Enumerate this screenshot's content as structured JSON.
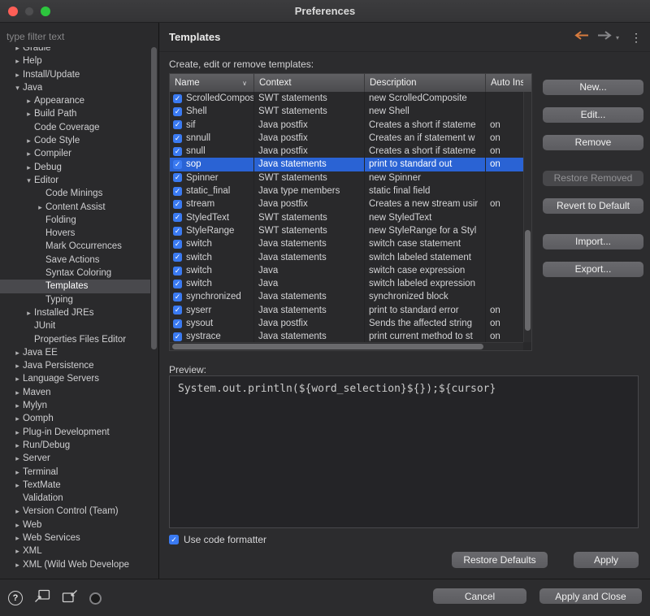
{
  "window": {
    "title": "Preferences"
  },
  "icons": {
    "check": "✓",
    "chevron_right": "▸",
    "chevron_down": "▾",
    "menu_dots": "⋮",
    "sort_down": "∨",
    "forward_dd": "▾",
    "help": "?"
  },
  "sidebar": {
    "filter_placeholder": "type filter text",
    "items": [
      {
        "label": "Gradle",
        "level": 0,
        "arrow": "right"
      },
      {
        "label": "Help",
        "level": 0,
        "arrow": "right"
      },
      {
        "label": "Install/Update",
        "level": 0,
        "arrow": "right"
      },
      {
        "label": "Java",
        "level": 0,
        "arrow": "down"
      },
      {
        "label": "Appearance",
        "level": 1,
        "arrow": "right"
      },
      {
        "label": "Build Path",
        "level": 1,
        "arrow": "right"
      },
      {
        "label": "Code Coverage",
        "level": 1,
        "arrow": "none"
      },
      {
        "label": "Code Style",
        "level": 1,
        "arrow": "right"
      },
      {
        "label": "Compiler",
        "level": 1,
        "arrow": "right"
      },
      {
        "label": "Debug",
        "level": 1,
        "arrow": "right"
      },
      {
        "label": "Editor",
        "level": 1,
        "arrow": "down"
      },
      {
        "label": "Code Minings",
        "level": 2,
        "arrow": "none"
      },
      {
        "label": "Content Assist",
        "level": 2,
        "arrow": "right"
      },
      {
        "label": "Folding",
        "level": 2,
        "arrow": "none"
      },
      {
        "label": "Hovers",
        "level": 2,
        "arrow": "none"
      },
      {
        "label": "Mark Occurrences",
        "level": 2,
        "arrow": "none"
      },
      {
        "label": "Save Actions",
        "level": 2,
        "arrow": "none"
      },
      {
        "label": "Syntax Coloring",
        "level": 2,
        "arrow": "none"
      },
      {
        "label": "Templates",
        "level": 2,
        "arrow": "none",
        "selected": true
      },
      {
        "label": "Typing",
        "level": 2,
        "arrow": "none"
      },
      {
        "label": "Installed JREs",
        "level": 1,
        "arrow": "right"
      },
      {
        "label": "JUnit",
        "level": 1,
        "arrow": "none"
      },
      {
        "label": "Properties Files Editor",
        "level": 1,
        "arrow": "none"
      },
      {
        "label": "Java EE",
        "level": 0,
        "arrow": "right"
      },
      {
        "label": "Java Persistence",
        "level": 0,
        "arrow": "right"
      },
      {
        "label": "Language Servers",
        "level": 0,
        "arrow": "right"
      },
      {
        "label": "Maven",
        "level": 0,
        "arrow": "right"
      },
      {
        "label": "Mylyn",
        "level": 0,
        "arrow": "right"
      },
      {
        "label": "Oomph",
        "level": 0,
        "arrow": "right"
      },
      {
        "label": "Plug-in Development",
        "level": 0,
        "arrow": "right"
      },
      {
        "label": "Run/Debug",
        "level": 0,
        "arrow": "right"
      },
      {
        "label": "Server",
        "level": 0,
        "arrow": "right"
      },
      {
        "label": "Terminal",
        "level": 0,
        "arrow": "right"
      },
      {
        "label": "TextMate",
        "level": 0,
        "arrow": "right"
      },
      {
        "label": "Validation",
        "level": 0,
        "arrow": "none"
      },
      {
        "label": "Version Control (Team)",
        "level": 0,
        "arrow": "right"
      },
      {
        "label": "Web",
        "level": 0,
        "arrow": "right"
      },
      {
        "label": "Web Services",
        "level": 0,
        "arrow": "right"
      },
      {
        "label": "XML",
        "level": 0,
        "arrow": "right"
      },
      {
        "label": "XML (Wild Web Develope",
        "level": 0,
        "arrow": "right"
      }
    ]
  },
  "main": {
    "title": "Templates",
    "subtitle": "Create, edit or remove templates:",
    "table": {
      "columns": [
        "Name",
        "Context",
        "Description",
        "Auto Insert"
      ],
      "rows": [
        {
          "name": "ScrolledComposite",
          "context": "SWT statements",
          "description": "new ScrolledComposite",
          "auto": "",
          "checked": true
        },
        {
          "name": "Shell",
          "context": "SWT statements",
          "description": "new Shell",
          "auto": "",
          "checked": true
        },
        {
          "name": "sif",
          "context": "Java postfix",
          "description": "Creates a short if stateme",
          "auto": "on",
          "checked": true
        },
        {
          "name": "snnull",
          "context": "Java postfix",
          "description": "Creates an if statement w",
          "auto": "on",
          "checked": true
        },
        {
          "name": "snull",
          "context": "Java postfix",
          "description": "Creates a short if stateme",
          "auto": "on",
          "checked": true
        },
        {
          "name": "sop",
          "context": "Java statements",
          "description": "print to standard out",
          "auto": "on",
          "checked": true,
          "selected": true
        },
        {
          "name": "Spinner",
          "context": "SWT statements",
          "description": "new Spinner",
          "auto": "",
          "checked": true
        },
        {
          "name": "static_final",
          "context": "Java type members",
          "description": "static final field",
          "auto": "",
          "checked": true
        },
        {
          "name": "stream",
          "context": "Java postfix",
          "description": "Creates a new stream usir",
          "auto": "on",
          "checked": true
        },
        {
          "name": "StyledText",
          "context": "SWT statements",
          "description": "new StyledText",
          "auto": "",
          "checked": true
        },
        {
          "name": "StyleRange",
          "context": "SWT statements",
          "description": "new StyleRange for a Styl",
          "auto": "",
          "checked": true
        },
        {
          "name": "switch",
          "context": "Java statements",
          "description": "switch case statement",
          "auto": "",
          "checked": true
        },
        {
          "name": "switch",
          "context": "Java statements",
          "description": "switch labeled statement",
          "auto": "",
          "checked": true
        },
        {
          "name": "switch",
          "context": "Java",
          "description": "switch case expression",
          "auto": "",
          "checked": true
        },
        {
          "name": "switch",
          "context": "Java",
          "description": "switch labeled expression",
          "auto": "",
          "checked": true
        },
        {
          "name": "synchronized",
          "context": "Java statements",
          "description": "synchronized block",
          "auto": "",
          "checked": true
        },
        {
          "name": "syserr",
          "context": "Java statements",
          "description": "print to standard error",
          "auto": "on",
          "checked": true
        },
        {
          "name": "sysout",
          "context": "Java postfix",
          "description": "Sends the affected string",
          "auto": "on",
          "checked": true
        },
        {
          "name": "systrace",
          "context": "Java statements",
          "description": "print current method to st",
          "auto": "on",
          "checked": true
        }
      ]
    },
    "side_buttons": [
      {
        "label": "New...",
        "key": "new",
        "disabled": false,
        "group": 0
      },
      {
        "label": "Edit...",
        "key": "edit",
        "disabled": false,
        "group": 0
      },
      {
        "label": "Remove",
        "key": "remove",
        "disabled": false,
        "group": 0
      },
      {
        "label": "Restore Removed",
        "key": "restore-removed",
        "disabled": true,
        "group": 1
      },
      {
        "label": "Revert to Default",
        "key": "revert-to-default",
        "disabled": false,
        "group": 1
      },
      {
        "label": "Import...",
        "key": "import",
        "disabled": false,
        "group": 2
      },
      {
        "label": "Export...",
        "key": "export",
        "disabled": false,
        "group": 2
      }
    ],
    "preview_label": "Preview:",
    "preview_code": "System.out.println(${word_selection}${});${cursor}",
    "use_code_formatter": "Use code formatter",
    "restore_defaults": "Restore Defaults",
    "apply": "Apply"
  },
  "footer": {
    "cancel": "Cancel",
    "apply_and_close": "Apply and Close"
  }
}
